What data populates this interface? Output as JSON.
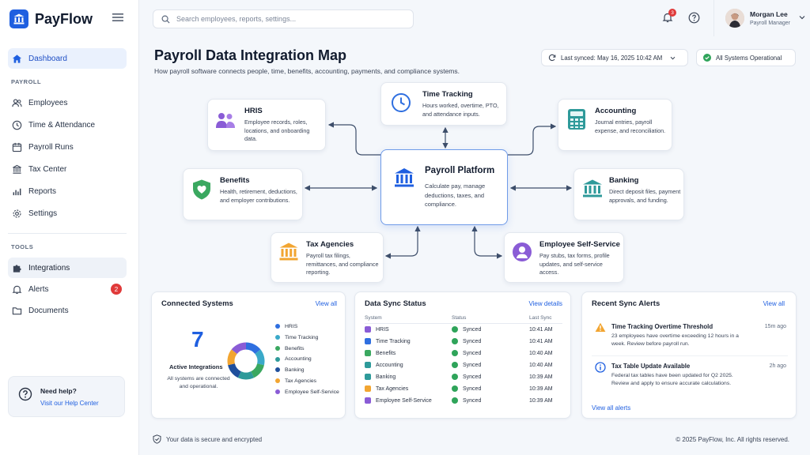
{
  "app": {
    "name": "PayFlow"
  },
  "sidebar": {
    "dashboard": "Dashboard",
    "section_payroll": "PAYROLL",
    "items": [
      {
        "label": "Employees"
      },
      {
        "label": "Time & Attendance"
      },
      {
        "label": "Payroll Runs"
      },
      {
        "label": "Tax Center"
      },
      {
        "label": "Reports"
      },
      {
        "label": "Settings"
      }
    ],
    "section_tools": "TOOLS",
    "tools": [
      {
        "label": "Integrations"
      },
      {
        "label": "Alerts",
        "badge": "2"
      },
      {
        "label": "Documents"
      }
    ],
    "help": {
      "title": "Need help?",
      "link": "Visit our Help Center"
    }
  },
  "header": {
    "search_placeholder": "Search employees, reports, settings...",
    "notification_count": "3",
    "user": {
      "name": "Morgan Lee",
      "role": "Payroll Manager"
    }
  },
  "page": {
    "title": "Payroll Data Integration Map",
    "subtitle": "How payroll software connects people, time, benefits, accounting, payments, and compliance systems.",
    "last_synced": "Last synced: May 16, 2025 10:42 AM",
    "status": "All Systems Operational"
  },
  "map": {
    "center": {
      "title": "Payroll Platform",
      "desc": "Calculate pay, manage deductions, taxes, and compliance."
    },
    "hris": {
      "title": "HRIS",
      "desc": "Employee records, roles, locations, and onboarding data."
    },
    "time": {
      "title": "Time Tracking",
      "desc": "Hours worked, overtime, PTO, and attendance inputs."
    },
    "accounting": {
      "title": "Accounting",
      "desc": "Journal entries, payroll expense, and reconciliation."
    },
    "benefits": {
      "title": "Benefits",
      "desc": "Health, retirement, deductions, and employer contributions."
    },
    "banking": {
      "title": "Banking",
      "desc": "Direct deposit files, payment approvals, and funding."
    },
    "tax": {
      "title": "Tax Agencies",
      "desc": "Payroll tax filings, remittances, and compliance reporting."
    },
    "ess": {
      "title": "Employee Self-Service",
      "desc": "Pay stubs, tax forms, profile updates, and self-service access."
    }
  },
  "connected": {
    "title": "Connected Systems",
    "view_all": "View all",
    "count": "7",
    "count_label": "Active Integrations",
    "note": "All systems are connected and operational.",
    "legend": [
      {
        "label": "HRIS",
        "color": "#2f6fe0"
      },
      {
        "label": "Time Tracking",
        "color": "#3aa9c9"
      },
      {
        "label": "Benefits",
        "color": "#3aa860"
      },
      {
        "label": "Accounting",
        "color": "#2e9a9a"
      },
      {
        "label": "Banking",
        "color": "#1f4f9c"
      },
      {
        "label": "Tax Agencies",
        "color": "#f2a531"
      },
      {
        "label": "Employee Self-Service",
        "color": "#8a5cd6"
      }
    ]
  },
  "sync": {
    "title": "Data Sync Status",
    "view_details": "View details",
    "columns": [
      "System",
      "Status",
      "Last Sync"
    ],
    "rows": [
      {
        "system": "HRIS",
        "status": "Synced",
        "time": "10:41 AM"
      },
      {
        "system": "Time Tracking",
        "status": "Synced",
        "time": "10:41 AM"
      },
      {
        "system": "Benefits",
        "status": "Synced",
        "time": "10:40 AM"
      },
      {
        "system": "Accounting",
        "status": "Synced",
        "time": "10:40 AM"
      },
      {
        "system": "Banking",
        "status": "Synced",
        "time": "10:39 AM"
      },
      {
        "system": "Tax Agencies",
        "status": "Synced",
        "time": "10:39 AM"
      },
      {
        "system": "Employee Self-Service",
        "status": "Synced",
        "time": "10:39 AM"
      }
    ]
  },
  "alerts": {
    "title": "Recent Sync Alerts",
    "view_all": "View all",
    "items": [
      {
        "title": "Time Tracking Overtime Threshold",
        "time": "15m ago",
        "desc": "23 employees have overtime exceeding 12 hours in a week. Review before payroll run."
      },
      {
        "title": "Tax Table Update Available",
        "time": "2h ago",
        "desc": "Federal tax tables have been updated for Q2 2025. Review and apply to ensure accurate calculations."
      }
    ],
    "view_all_alerts": "View all alerts"
  },
  "footer": {
    "secure": "Your data is secure and encrypted",
    "copyright": "© 2025 PayFlow, Inc. All rights reserved."
  }
}
